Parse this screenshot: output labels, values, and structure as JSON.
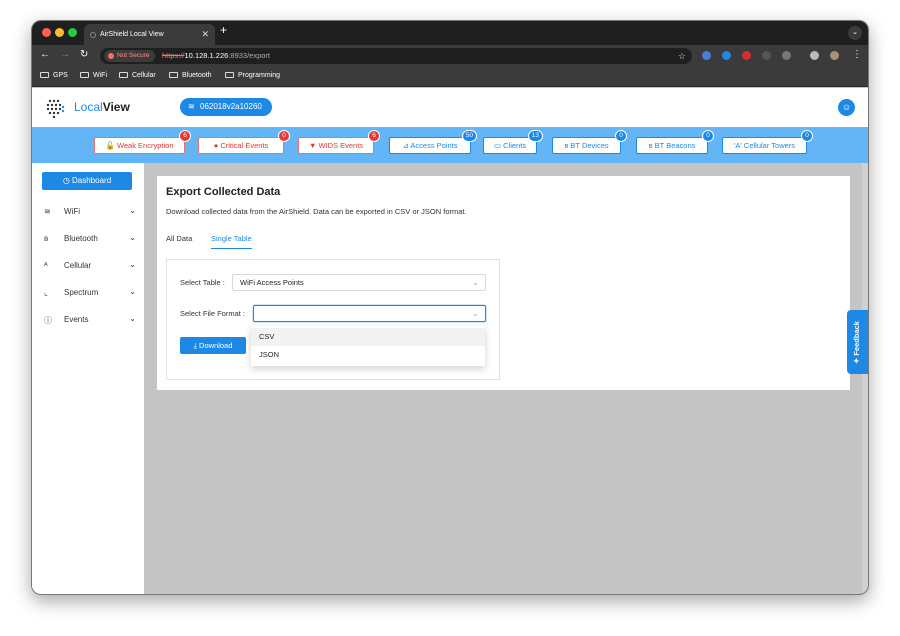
{
  "browser": {
    "tab_title": "AirShield Local View",
    "new_tab": "+",
    "not_secure": "Not Secure",
    "url_scheme": "https://",
    "url_host": "10.128.1.226",
    "url_path": ":8933/export",
    "bookmarks": [
      "GPS",
      "WiFi",
      "Cellular",
      "Bluetooth",
      "Programming"
    ]
  },
  "header": {
    "logo_prefix": "Local",
    "logo_suffix": "View",
    "device_id": "062018v2a10260"
  },
  "stats": [
    {
      "label": "Weak Encryption",
      "count": "6",
      "icon": "🔓",
      "tone": "red"
    },
    {
      "label": "Critical Events",
      "count": "0",
      "icon": "●",
      "tone": "red"
    },
    {
      "label": "WIDS Events",
      "count": "6",
      "icon": "▼",
      "tone": "red"
    },
    {
      "label": "Access Points",
      "count": "50",
      "icon": "⊿",
      "tone": "blue"
    },
    {
      "label": "Clients",
      "count": "13",
      "icon": "▭",
      "tone": "blue"
    },
    {
      "label": "BT Devices",
      "count": "0",
      "icon": "ʙ",
      "tone": "blue"
    },
    {
      "label": "BT Beacons",
      "count": "0",
      "icon": "ʙ",
      "tone": "blue"
    },
    {
      "label": "Cellular Towers",
      "count": "0",
      "icon": "'A'",
      "tone": "blue"
    }
  ],
  "sidebar": {
    "dashboard": "Dashboard",
    "items": [
      {
        "label": "WiFi",
        "icon": "≋"
      },
      {
        "label": "Bluetooth",
        "icon": "ʙ"
      },
      {
        "label": "Cellular",
        "icon": "ᴬ"
      },
      {
        "label": "Spectrum",
        "icon": "⌞"
      },
      {
        "label": "Events",
        "icon": "ⓘ"
      }
    ]
  },
  "main": {
    "title": "Export Collected Data",
    "description": "Download collected data from the AirShield. Data can be exported in CSV or JSON format.",
    "tabs": [
      "All Data",
      "Single Table"
    ],
    "active_tab": "Single Table",
    "select_table_label": "Select Table :",
    "select_table_value": "WiFi Access Points",
    "file_format_label": "Select File Format :",
    "file_format_value": "",
    "download_label": "Download",
    "format_options": [
      "CSV",
      "JSON"
    ]
  },
  "feedback": "Feedback",
  "colors": {
    "primary": "#1e88e5",
    "stats_bg": "#64b5f6",
    "alert": "#e53935"
  }
}
